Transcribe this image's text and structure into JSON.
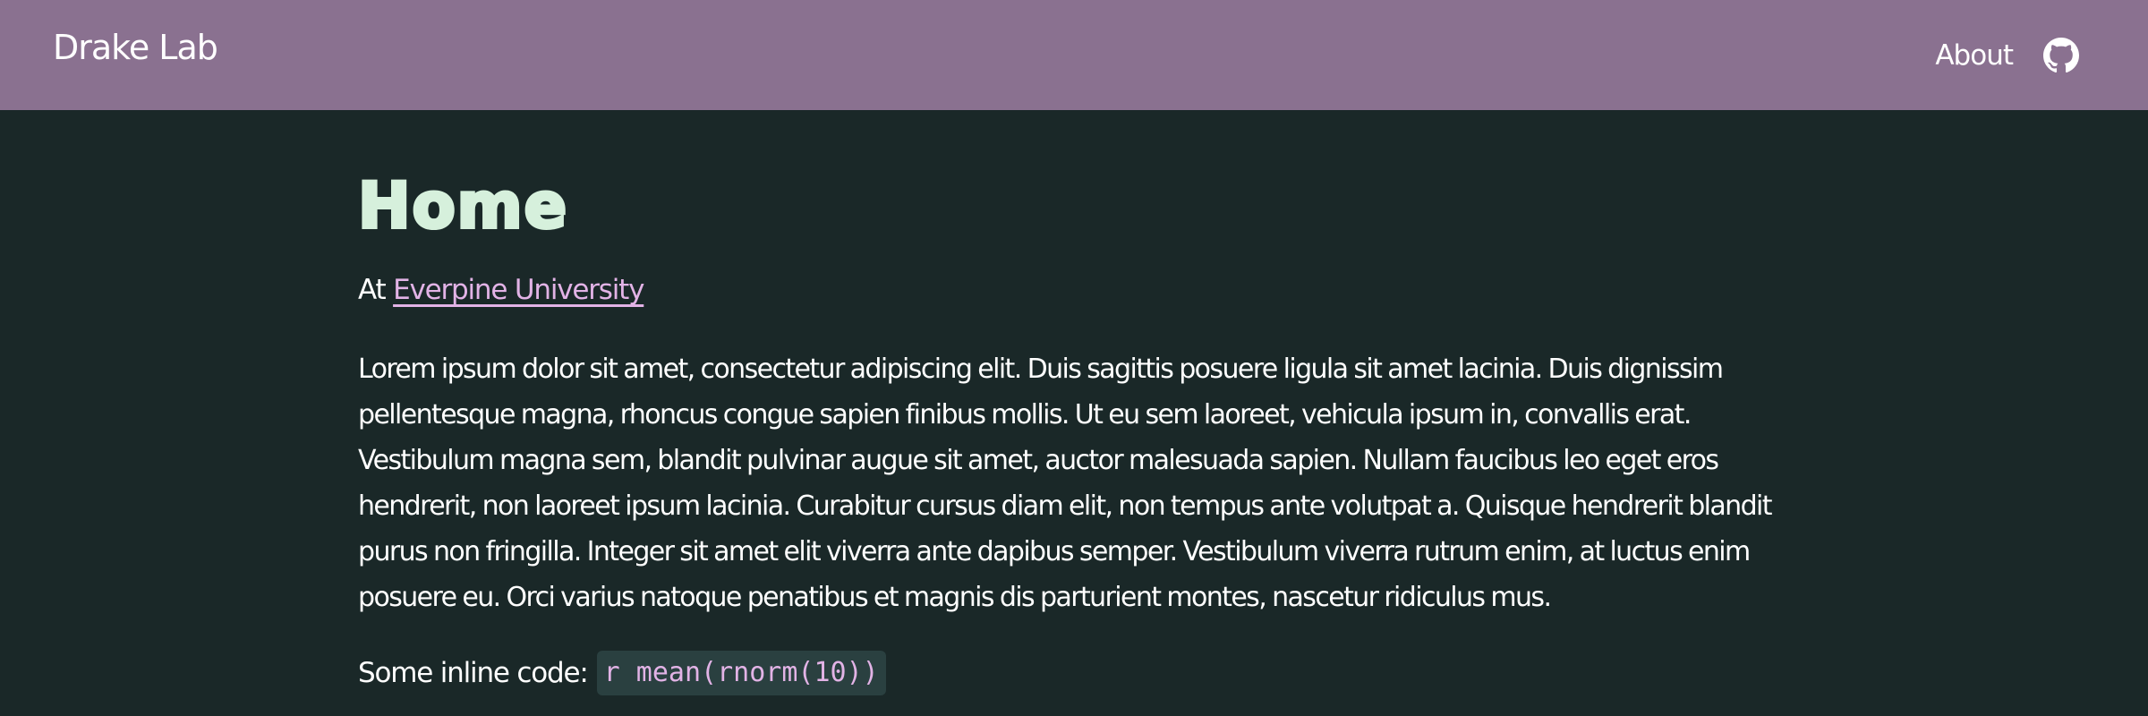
{
  "colors": {
    "navbar_bg": "#8a7190",
    "page_bg": "#1a2828",
    "title": "#d6f0dc",
    "link": "#e2b3e6",
    "code_bg": "#2a4040"
  },
  "navbar": {
    "brand": "Drake Lab",
    "about_label": "About",
    "github_icon": "github-icon"
  },
  "main": {
    "title": "Home",
    "affiliation_prefix": "At",
    "affiliation_link": "Everpine University",
    "body_text": "Lorem ipsum dolor sit amet, consectetur adipiscing elit. Duis sagittis posuere ligula sit amet lacinia. Duis dignissim pellentesque magna, rhoncus congue sapien finibus mollis. Ut eu sem laoreet, vehicula ipsum in, convallis erat. Vestibulum magna sem, blandit pulvinar augue sit amet, auctor malesuada sapien. Nullam faucibus leo eget eros hendrerit, non laoreet ipsum lacinia. Curabitur cursus diam elit, non tempus ante volutpat a. Quisque hendrerit blandit purus non fringilla. Integer sit amet elit viverra ante dapibus semper. Vestibulum viverra rutrum enim, at luctus enim posuere eu. Orci varius natoque penatibus et magnis dis parturient montes, nascetur ridiculus mus.",
    "inline_code_label": "Some inline code:",
    "inline_code": "r mean(rnorm(10))"
  }
}
